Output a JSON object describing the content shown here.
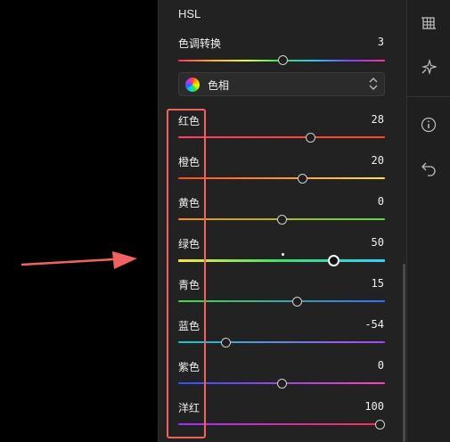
{
  "panel": {
    "title": "HSL",
    "hue_shift": {
      "label": "色调转换",
      "value": "3",
      "level": 3
    },
    "channel_select": {
      "label": "色相"
    },
    "channels": [
      {
        "key": "red",
        "label": "红色",
        "value": "28",
        "level": 28,
        "active": false,
        "gradient": [
          "#ff3d6e",
          "#ff4a20"
        ]
      },
      {
        "key": "orange",
        "label": "橙色",
        "value": "20",
        "level": 20,
        "active": false,
        "gradient": [
          "#ff4a20",
          "#ffe040"
        ]
      },
      {
        "key": "yellow",
        "label": "黄色",
        "value": "0",
        "level": 0,
        "active": false,
        "gradient": [
          "#ff8c1a",
          "#58e030"
        ]
      },
      {
        "key": "green",
        "label": "绿色",
        "value": "50",
        "level": 50,
        "active": true,
        "gradient": [
          "#ffe640",
          "#38e070",
          "#38d0ff"
        ]
      },
      {
        "key": "aqua",
        "label": "青色",
        "value": "15",
        "level": 15,
        "active": false,
        "gradient": [
          "#44dd44",
          "#3070ff"
        ]
      },
      {
        "key": "blue",
        "label": "蓝色",
        "value": "-54",
        "level": -54,
        "active": false,
        "gradient": [
          "#18c8c8",
          "#b040ff"
        ]
      },
      {
        "key": "purple",
        "label": "紫色",
        "value": "0",
        "level": 0,
        "active": false,
        "gradient": [
          "#3050ff",
          "#ff40c0"
        ]
      },
      {
        "key": "magenta",
        "label": "洋红",
        "value": "100",
        "level": 100,
        "active": false,
        "gradient": [
          "#a030ff",
          "#ff3050"
        ]
      }
    ]
  },
  "toolbar": {
    "icons": [
      "crop-grid-icon",
      "magic-sparkle-icon",
      "info-icon",
      "undo-icon"
    ]
  },
  "annotation": {
    "highlight_color": "#f06262",
    "arrow_color": "#f06262"
  }
}
